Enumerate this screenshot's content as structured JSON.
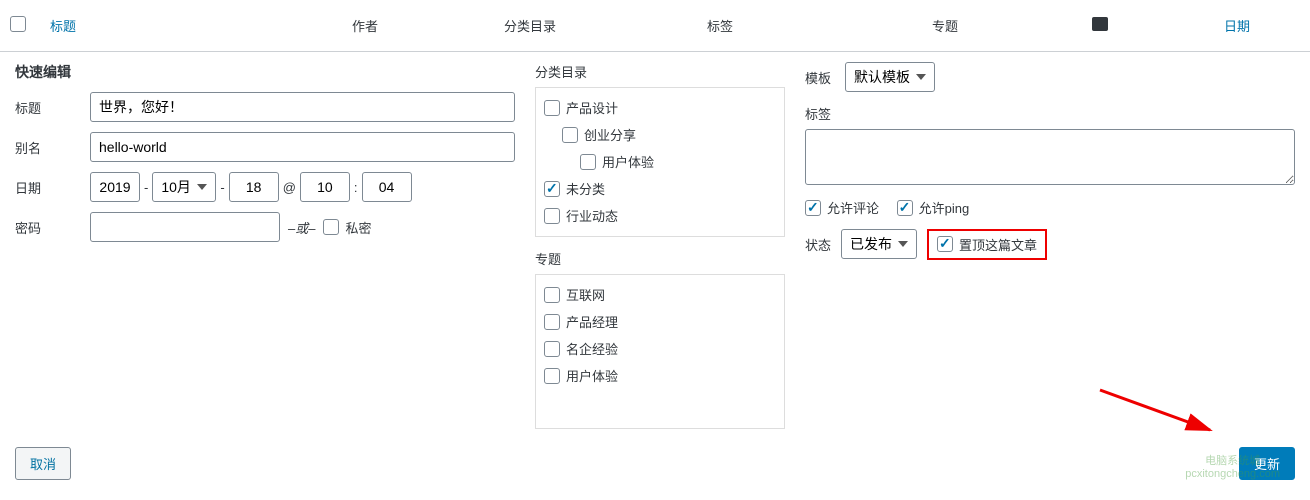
{
  "header": {
    "title": "标题",
    "author": "作者",
    "category": "分类目录",
    "tags": "标签",
    "topic": "专题",
    "date": "日期"
  },
  "quick_edit": {
    "legend": "快速编辑",
    "title_label": "标题",
    "title_value": "世界，您好！",
    "slug_label": "别名",
    "slug_value": "hello-world",
    "date_label": "日期",
    "year": "2019",
    "month": "10月",
    "day": "18",
    "hour": "10",
    "minute": "04",
    "at_symbol": "@",
    "colon": ":",
    "dash": "-",
    "password_label": "密码",
    "or_text": "–或–",
    "private_label": "私密"
  },
  "categories": {
    "label": "分类目录",
    "items": [
      {
        "name": "产品设计",
        "checked": false,
        "indent": 0
      },
      {
        "name": "创业分享",
        "checked": false,
        "indent": 1
      },
      {
        "name": "用户体验",
        "checked": false,
        "indent": 2
      },
      {
        "name": "未分类",
        "checked": true,
        "indent": 0
      },
      {
        "name": "行业动态",
        "checked": false,
        "indent": 0
      }
    ]
  },
  "topics": {
    "label": "专题",
    "items": [
      {
        "name": "互联网",
        "checked": false
      },
      {
        "name": "产品经理",
        "checked": false
      },
      {
        "name": "名企经验",
        "checked": false
      },
      {
        "name": "用户体验",
        "checked": false
      }
    ]
  },
  "template": {
    "label": "模板",
    "value": "默认模板"
  },
  "tags": {
    "label": "标签"
  },
  "options": {
    "allow_comments": "允许评论",
    "allow_ping": "允许ping"
  },
  "status": {
    "label": "状态",
    "value": "已发布",
    "sticky_label": "置顶这篇文章"
  },
  "actions": {
    "cancel": "取消",
    "update": "更新"
  },
  "watermark": {
    "line1": "电脑系统城",
    "line2": "pcxitongcheng.com"
  }
}
